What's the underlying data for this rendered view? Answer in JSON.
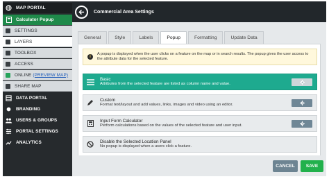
{
  "sidebar": {
    "items": [
      {
        "label": "MAP PORTAL",
        "icon": "globe-icon"
      },
      {
        "label": "Calculator Popup",
        "icon": "calculator-icon"
      },
      {
        "label": "SETTINGS",
        "icon": "square-icon"
      },
      {
        "label": "LAYERS",
        "icon": "square-icon"
      },
      {
        "label": "TOOLBOX",
        "icon": "square-icon"
      },
      {
        "label": "ACCESS",
        "icon": "square-icon"
      },
      {
        "label": "ONLINE",
        "link": "(PREVIEW MAP)",
        "icon": "status-green-icon"
      },
      {
        "label": "SHARE MAP",
        "icon": "square-icon"
      },
      {
        "label": "DATA PORTAL",
        "icon": "data-icon"
      },
      {
        "label": "BRANDING",
        "icon": "dot-icon"
      },
      {
        "label": "USERS & GROUPS",
        "icon": "users-icon"
      },
      {
        "label": "PORTAL SETTINGS",
        "icon": "settings-icon"
      },
      {
        "label": "ANALYTICS",
        "icon": "analytics-icon"
      }
    ]
  },
  "header": {
    "title": "Commercial Area Settings"
  },
  "tabs": [
    "General",
    "Style",
    "Labels",
    "Popup",
    "Formatting",
    "Update Data"
  ],
  "active_tab": "Popup",
  "info": {
    "line1": "A popup is displayed when the user clicks on a feature on the map or in search results. The popup gives the user access to",
    "line2": "the attribute data for the selected feature."
  },
  "options": [
    {
      "name": "Basic",
      "desc": "Attributes from the selected feature are listed as column name and value.",
      "selected": true
    },
    {
      "name": "Custom",
      "desc": "Format text/layout and add values, links, images and video using an editor.",
      "selected": false
    },
    {
      "name": "Input Form Calculator",
      "desc": "Perform calculations based on the values of the selected feature and user input.",
      "selected": false
    },
    {
      "name": "Disable the Selected Location Panel",
      "desc": "No popup is displayed when a users click a feature.",
      "selected": false
    }
  ],
  "footer": {
    "cancel": "CANCEL",
    "save": "SAVE"
  },
  "colors": {
    "accent": "#1eaa8f",
    "save": "#22b14c",
    "sidebar": "#262a2d"
  }
}
